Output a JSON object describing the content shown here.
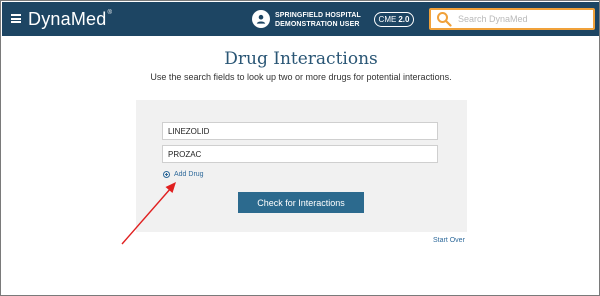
{
  "header": {
    "brand": "DynaMed",
    "brand_mark": "®",
    "user_line1": "SPRINGFIELD HOSPITAL",
    "user_line2": "DEMONSTRATION USER",
    "cme_label": "CME",
    "cme_value": "2.0",
    "search_placeholder": "Search DynaMed",
    "colors": {
      "bar": "#1d4563",
      "search_border": "#f0a13a"
    }
  },
  "main": {
    "title": "Drug Interactions",
    "subtitle": "Use the search fields to look up two or more drugs for potential interactions.",
    "drug_1": "LINEZOLID",
    "drug_2": "PROZAC",
    "add_drug_label": "Add Drug",
    "check_button": "Check for Interactions",
    "start_over": "Start Over",
    "colors": {
      "title": "#2a5675",
      "button": "#2c6a8e",
      "link": "#2f6a9b",
      "annotation_arrow": "#e02020"
    }
  },
  "icons": [
    "menu-icon",
    "user-icon",
    "search-icon",
    "add-circle-icon",
    "annotation-arrow"
  ]
}
